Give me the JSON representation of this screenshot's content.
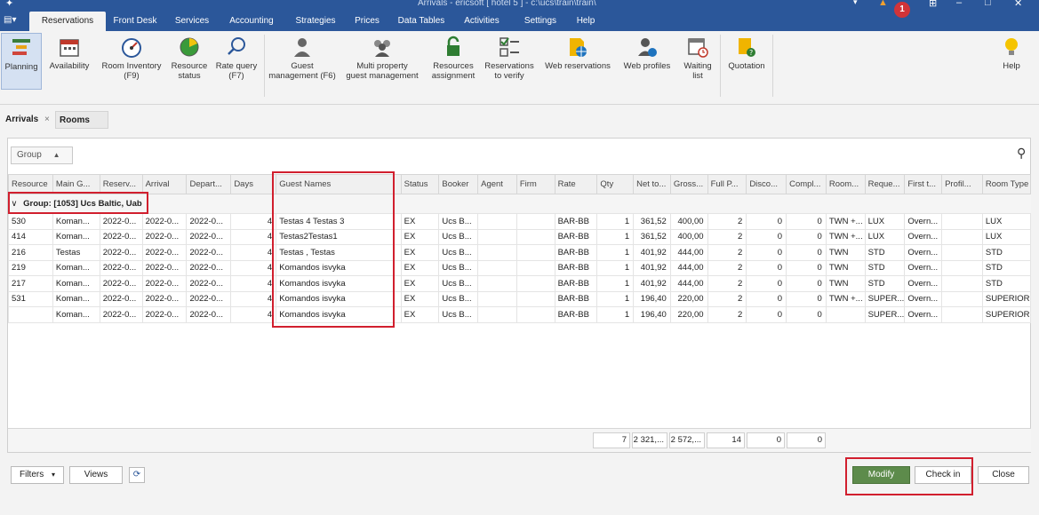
{
  "window": {
    "title": "Arrivals - ericsoft [ hotel 5 ] - c:\\ucs\\train\\train\\",
    "notification_count": "1"
  },
  "menu": {
    "app_icon": "app-menu-icon",
    "tabs": [
      "Reservations",
      "Front Desk",
      "Services",
      "Accounting",
      "Strategies",
      "Prices",
      "Data Tables",
      "Activities",
      "Settings",
      "Help"
    ],
    "active": "Reservations"
  },
  "ribbon": {
    "buttons": [
      {
        "line1": "Planning",
        "line2": "",
        "icon": "planning-icon"
      },
      {
        "line1": "Availability",
        "line2": "",
        "icon": "calendar-icon"
      },
      {
        "line1": "Room Inventory",
        "line2": "(F9)",
        "icon": "gauge-icon"
      },
      {
        "line1": "Resource",
        "line2": "status",
        "icon": "pie-chart-icon"
      },
      {
        "line1": "Rate query",
        "line2": "(F7)",
        "icon": "search-icon"
      },
      {
        "line1": "Guest",
        "line2": "management (F6)",
        "icon": "guest-icon"
      },
      {
        "line1": "Multi property",
        "line2": "guest management",
        "icon": "group-icon"
      },
      {
        "line1": "Resources",
        "line2": "assignment",
        "icon": "lock-icon"
      },
      {
        "line1": "Reservations",
        "line2": "to verify",
        "icon": "checklist-icon"
      },
      {
        "line1": "Web reservations",
        "line2": "",
        "icon": "globe-doc-icon"
      },
      {
        "line1": "Web profiles",
        "line2": "",
        "icon": "user-web-icon"
      },
      {
        "line1": "Waiting",
        "line2": "list",
        "icon": "calendar-clock-icon"
      },
      {
        "line1": "Quotation",
        "line2": "",
        "icon": "quotation-icon"
      },
      {
        "line1": "Help",
        "line2": "",
        "icon": "lightbulb-icon"
      }
    ]
  },
  "doc_tabs": {
    "arrivals": "Arrivals",
    "close_glyph": "×",
    "rooms": "Rooms"
  },
  "group_box": {
    "label": "Group",
    "caret": "▲"
  },
  "grid": {
    "columns": [
      "Resource",
      "Main G...",
      "Reserv...",
      "Arrival",
      "Depart...",
      "Days",
      "Guest Names",
      "Status",
      "Booker",
      "Agent",
      "Firm",
      "Rate",
      "Qty",
      "Net to...",
      "Gross...",
      "Full P...",
      "Disco...",
      "Compl...",
      "Room...",
      "Reque...",
      "First t...",
      "Profil...",
      "Room Type"
    ],
    "group_row": "Group: [1053] Ucs Baltic, Uab",
    "group_chevron": "∨",
    "rows": [
      [
        "530",
        "Koman...",
        "2022-0...",
        "2022-0...",
        "2022-0...",
        "4",
        "Testas 4 Testas 3",
        "EX",
        "Ucs B...",
        "",
        "",
        "BAR-BB",
        "1",
        "361,52",
        "400,00",
        "2",
        "0",
        "0",
        "TWN +...",
        "LUX",
        "Overn...",
        "",
        "LUX"
      ],
      [
        "414",
        "Koman...",
        "2022-0...",
        "2022-0...",
        "2022-0...",
        "4",
        "Testas2Testas1",
        "EX",
        "Ucs B...",
        "",
        "",
        "BAR-BB",
        "1",
        "361,52",
        "400,00",
        "2",
        "0",
        "0",
        "TWN +...",
        "LUX",
        "Overn...",
        "",
        "LUX"
      ],
      [
        "216",
        "Testas",
        "2022-0...",
        "2022-0...",
        "2022-0...",
        "4",
        "Testas , Testas",
        "EX",
        "Ucs B...",
        "",
        "",
        "BAR-BB",
        "1",
        "401,92",
        "444,00",
        "2",
        "0",
        "0",
        "TWN",
        "STD",
        "Overn...",
        "",
        "STD"
      ],
      [
        "219",
        "Koman...",
        "2022-0...",
        "2022-0...",
        "2022-0...",
        "4",
        "Komandos isvyka",
        "EX",
        "Ucs B...",
        "",
        "",
        "BAR-BB",
        "1",
        "401,92",
        "444,00",
        "2",
        "0",
        "0",
        "TWN",
        "STD",
        "Overn...",
        "",
        "STD"
      ],
      [
        "217",
        "Koman...",
        "2022-0...",
        "2022-0...",
        "2022-0...",
        "4",
        "Komandos isvyka",
        "EX",
        "Ucs B...",
        "",
        "",
        "BAR-BB",
        "1",
        "401,92",
        "444,00",
        "2",
        "0",
        "0",
        "TWN",
        "STD",
        "Overn...",
        "",
        "STD"
      ],
      [
        "531",
        "Koman...",
        "2022-0...",
        "2022-0...",
        "2022-0...",
        "4",
        "Komandos isvyka",
        "EX",
        "Ucs B...",
        "",
        "",
        "BAR-BB",
        "1",
        "196,40",
        "220,00",
        "2",
        "0",
        "0",
        "TWN +...",
        "SUPER...",
        "Overn...",
        "",
        "SUPERIOR"
      ],
      [
        "",
        "Koman...",
        "2022-0...",
        "2022-0...",
        "2022-0...",
        "4",
        "Komandos isvyka",
        "EX",
        "Ucs B...",
        "",
        "",
        "BAR-BB",
        "1",
        "196,40",
        "220,00",
        "2",
        "0",
        "0",
        "",
        "SUPER...",
        "Overn...",
        "",
        "SUPERIOR"
      ]
    ],
    "totals": {
      "qty": "7",
      "net": "2 321,...",
      "gross": "2 572,...",
      "full": "14",
      "disc": "0",
      "compl": "0"
    }
  },
  "footer": {
    "filters": "Filters",
    "filters_caret": "▾",
    "views": "Views",
    "modify": "Modify",
    "checkin": "Check in",
    "close": "Close"
  },
  "colors": {
    "accent": "#2b579a",
    "modify": "#5d8b4b",
    "highlight": "#d11f2e"
  }
}
